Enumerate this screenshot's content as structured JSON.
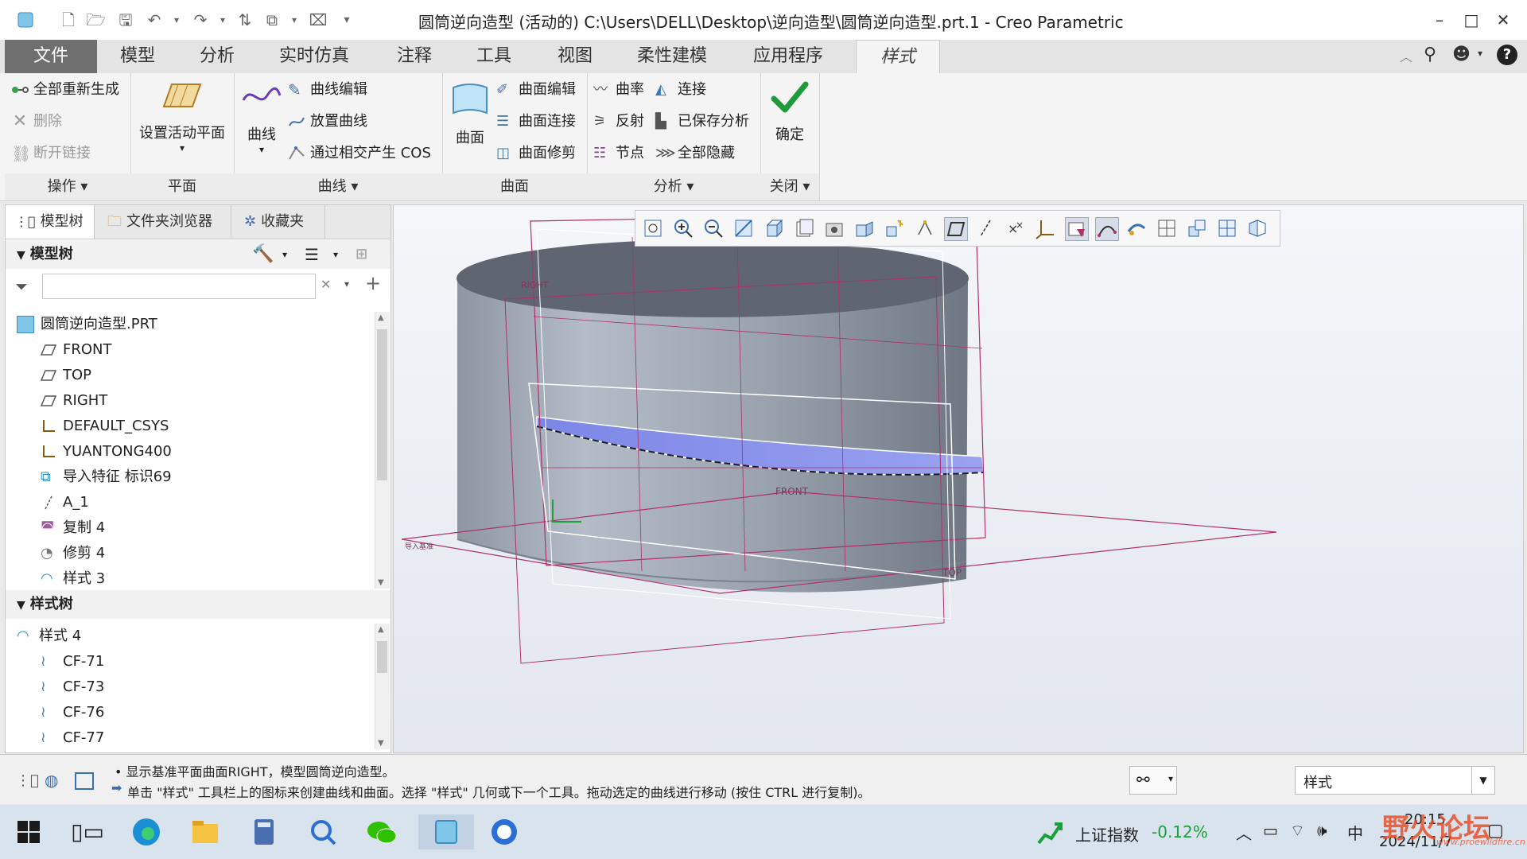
{
  "titlebar": {
    "title": "圆筒逆向造型 (活动的) C:\\Users\\DELL\\Desktop\\逆向造型\\圆筒逆向造型.prt.1 - Creo Parametric",
    "minimize": "–",
    "maximize": "□",
    "close": "✕"
  },
  "tabs": [
    "文件",
    "模型",
    "分析",
    "实时仿真",
    "注释",
    "工具",
    "视图",
    "柔性建模",
    "应用程序",
    "样式"
  ],
  "ribbon": {
    "ops": {
      "regen": "全部重新生成",
      "delete": "删除",
      "break_link": "断开链接",
      "label": "操作 ▾"
    },
    "plane": {
      "set_active": "设置活动平面",
      "label": "平面"
    },
    "curve": {
      "curve": "曲线",
      "edit": "曲线编辑",
      "place": "放置曲线",
      "cos": "通过相交产生 COS",
      "label": "曲线 ▾"
    },
    "surface": {
      "surface": "曲面",
      "edit": "曲面编辑",
      "connect": "曲面连接",
      "trim": "曲面修剪",
      "label": "曲面"
    },
    "analysis": {
      "curvature": "曲率",
      "connect": "连接",
      "reflect": "反射",
      "saved": "已保存分析",
      "nodes": "节点",
      "hide_all": "全部隐藏",
      "label": "分析 ▾"
    },
    "close": {
      "ok": "确定",
      "label": "关闭 ▾"
    }
  },
  "left_panel": {
    "tabs": [
      "模型树",
      "文件夹浏览器",
      "收藏夹"
    ],
    "model_tree_title": "模型树",
    "search_placeholder": "",
    "model_items": [
      "圆筒逆向造型.PRT",
      "FRONT",
      "TOP",
      "RIGHT",
      "DEFAULT_CSYS",
      "YUANTONG400",
      "导入特征 标识69",
      "A_1",
      "复制 4",
      "修剪 4",
      "样式 3"
    ],
    "style_tree_title": "样式树",
    "style_items": [
      "样式 4",
      "CF-71",
      "CF-73",
      "CF-76",
      "CF-77"
    ]
  },
  "viewport": {
    "labels": {
      "right": "RIGHT",
      "front": "FRONT",
      "top": "TOP",
      "csys": "导入基准"
    }
  },
  "status": {
    "msg1": "• 显示基准平面曲面RIGHT，模型圆筒逆向造型。",
    "msg2": "单击 \"样式\" 工具栏上的图标来创建曲线和曲面。选择 \"样式\" 几何或下一个工具。拖动选定的曲线进行移动 (按住 CTRL 进行复制)。",
    "filter_value": "样式"
  },
  "taskbar": {
    "stock_name": "上证指数",
    "stock_change": "-0.12%",
    "ime": "中",
    "time": "20:15",
    "date": "2024/11/7",
    "watermark": "野火论坛",
    "watermark_url": "www.proewildfire.cn"
  },
  "colors": {
    "accent_file": "#6f6f6f",
    "stock_green": "#1aa03a",
    "plane_line": "#b0306a"
  }
}
